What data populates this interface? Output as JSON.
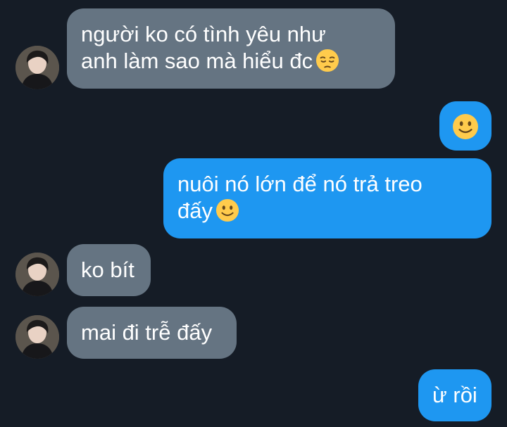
{
  "conversation": {
    "messages": [
      {
        "direction": "incoming",
        "lines": [
          "người ko có tình yêu như",
          "anh làm sao mà hiểu đc"
        ],
        "emoji": "pensive-face"
      },
      {
        "direction": "outgoing",
        "lines": [],
        "emoji": "slightly-smiling-face"
      },
      {
        "direction": "outgoing",
        "lines": [
          "nuôi nó lớn để nó trả treo",
          "đấy"
        ],
        "emoji": "slightly-smiling-face"
      },
      {
        "direction": "incoming",
        "lines": [
          "ko bít"
        ],
        "emoji": ""
      },
      {
        "direction": "incoming",
        "lines": [
          "mai đi trễ đấy"
        ],
        "emoji": ""
      },
      {
        "direction": "outgoing",
        "lines": [
          "ừ rồi"
        ],
        "emoji": ""
      }
    ]
  },
  "colors": {
    "background": "#151c26",
    "incoming_bubble": "#657482",
    "outgoing_bubble": "#1e97f1",
    "text": "#ffffff"
  }
}
